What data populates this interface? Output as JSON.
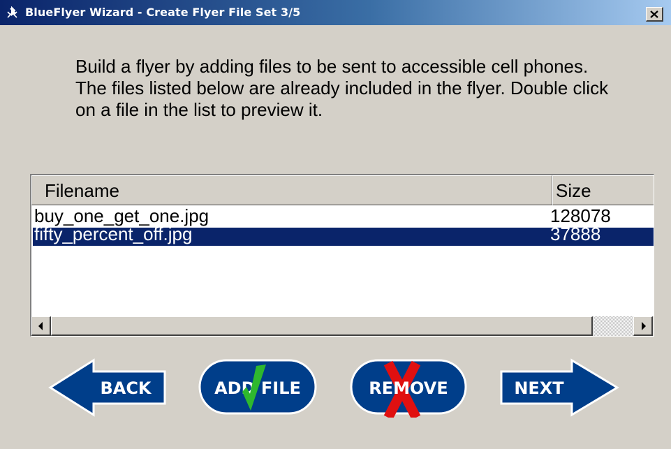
{
  "window": {
    "title": "BlueFlyer Wizard - Create Flyer File Set 3/5",
    "close_label": "×"
  },
  "instructions": "Build a flyer by adding files to be sent to accessible cell phones. The files listed below are already included in the flyer. Double click on a file in the list to preview it.",
  "file_list": {
    "columns": [
      "Filename",
      "Size"
    ],
    "rows": [
      {
        "name": "buy_one_get_one.jpg",
        "size": "128078",
        "selected": false
      },
      {
        "name": "fifty_percent_off.jpg",
        "size": "37888",
        "selected": true
      }
    ]
  },
  "buttons": {
    "back": "BACK",
    "add_file": "ADD FILE",
    "remove": "REMOVE",
    "next": "NEXT"
  },
  "icons": {
    "app": "bluetooth-icon",
    "add": "green-check-icon",
    "remove": "red-x-icon",
    "scroll_left": "left-arrow-icon",
    "scroll_right": "right-arrow-icon"
  },
  "colors": {
    "button_blue": "#003e8a",
    "selection": "#0a246a",
    "check_green": "#2eb82e",
    "remove_red": "#e01010"
  }
}
